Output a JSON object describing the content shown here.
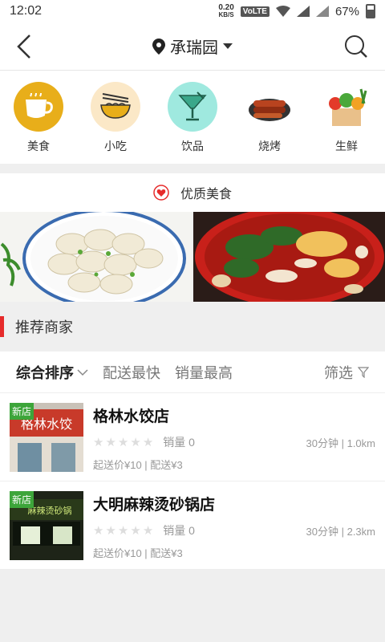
{
  "status": {
    "time": "12:02",
    "netspeed": "0.20",
    "netspeed_unit": "KB/S",
    "volte": "VoLTE",
    "battery": "67%"
  },
  "header": {
    "location": "承瑞园"
  },
  "categories": [
    {
      "label": "美食",
      "icon": "coffee-cup-icon",
      "color": "#e8ae1a"
    },
    {
      "label": "小吃",
      "icon": "noodle-bowl-icon",
      "color": "#fbe8c7"
    },
    {
      "label": "饮品",
      "icon": "cocktail-icon",
      "color": "#9fe9df"
    },
    {
      "label": "烧烤",
      "icon": "bbq-icon",
      "color": "#ffffff"
    },
    {
      "label": "生鲜",
      "icon": "vegetables-icon",
      "color": "#ffffff"
    }
  ],
  "quality": {
    "title": "优质美食"
  },
  "recommend": {
    "title": "推荐商家"
  },
  "sortbar": {
    "comprehensive": "综合排序",
    "fastest": "配送最快",
    "top_sales": "销量最高",
    "filter": "筛选"
  },
  "stores": [
    {
      "name": "格林水饺店",
      "tag": "新店",
      "sales": "销量 0",
      "time_dist": "30分钟 | 1.0km",
      "fee": "起送价¥10 | 配送¥3",
      "sign": "格林水饺"
    },
    {
      "name": "大明麻辣烫砂锅店",
      "tag": "新店",
      "sales": "销量 0",
      "time_dist": "30分钟 | 2.3km",
      "fee": "起送价¥10 | 配送¥3",
      "sign": "麻辣烫砂锅"
    }
  ],
  "colors": {
    "accent": "#e62b2b",
    "new_tag": "#3da53a"
  }
}
